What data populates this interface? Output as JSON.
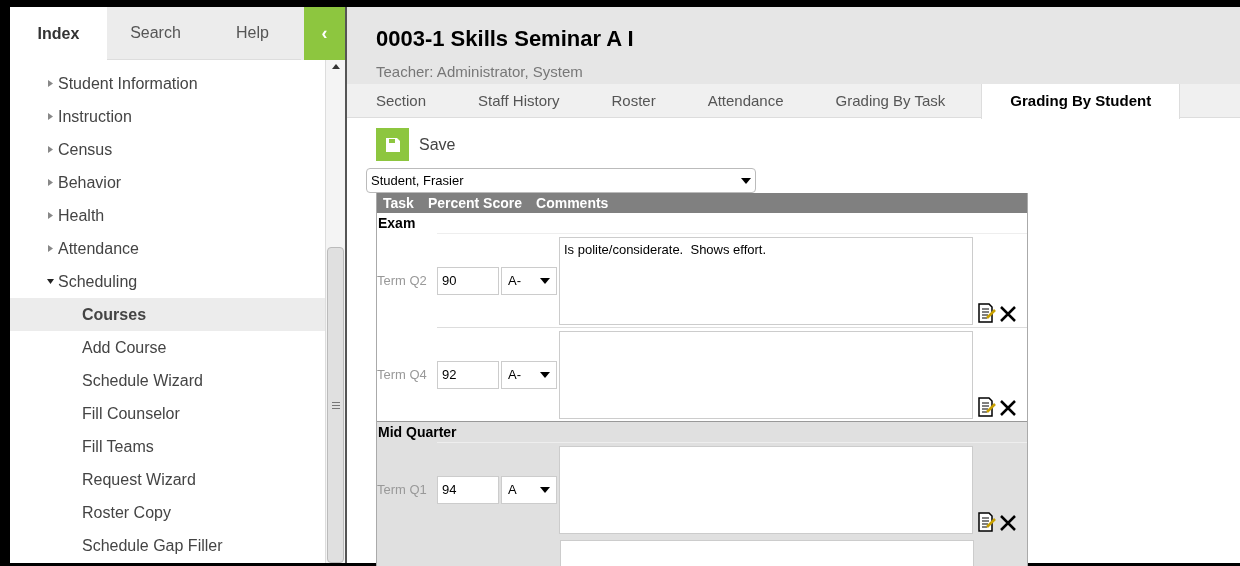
{
  "sidebar": {
    "tabs": [
      {
        "label": "Index",
        "selected": true
      },
      {
        "label": "Search",
        "selected": false
      },
      {
        "label": "Help",
        "selected": false
      }
    ],
    "collapse_button": "‹",
    "items": [
      {
        "label": "Student Information",
        "expanded": false
      },
      {
        "label": "Instruction",
        "expanded": false
      },
      {
        "label": "Census",
        "expanded": false
      },
      {
        "label": "Behavior",
        "expanded": false
      },
      {
        "label": "Health",
        "expanded": false
      },
      {
        "label": "Attendance",
        "expanded": false
      },
      {
        "label": "Scheduling",
        "expanded": true,
        "children": [
          {
            "label": "Courses",
            "selected": true
          },
          {
            "label": "Add Course",
            "selected": false
          },
          {
            "label": "Schedule Wizard",
            "selected": false
          },
          {
            "label": "Fill Counselor",
            "selected": false
          },
          {
            "label": "Fill Teams",
            "selected": false
          },
          {
            "label": "Request Wizard",
            "selected": false
          },
          {
            "label": "Roster Copy",
            "selected": false
          },
          {
            "label": "Schedule Gap Filler",
            "selected": false
          }
        ]
      }
    ]
  },
  "header": {
    "title": "0003-1 Skills Seminar A I",
    "teacher": "Teacher: Administrator, System"
  },
  "tabs": [
    {
      "label": "Section",
      "selected": false
    },
    {
      "label": "Staff History",
      "selected": false
    },
    {
      "label": "Roster",
      "selected": false
    },
    {
      "label": "Attendance",
      "selected": false
    },
    {
      "label": "Grading By Task",
      "selected": false
    },
    {
      "label": "Grading By Student",
      "selected": true
    }
  ],
  "save_button": "Save",
  "student_select": "Student, Frasier",
  "table": {
    "columns": [
      "Task",
      "Percent Score",
      "Comments"
    ],
    "groups": [
      {
        "name": "Exam",
        "shaded": false,
        "rows": [
          {
            "kind": "full",
            "term": "Term Q2",
            "score": "90",
            "grade": "A-",
            "comment": "Is polite/considerate.  Shows effort."
          },
          {
            "kind": "full",
            "term": "Term Q4",
            "score": "92",
            "grade": "A-",
            "comment": ""
          }
        ]
      },
      {
        "name": "Mid Quarter",
        "shaded": true,
        "rows": [
          {
            "kind": "full",
            "term": "Term Q1",
            "score": "94",
            "grade": "A",
            "comment": ""
          },
          {
            "kind": "partial"
          }
        ]
      }
    ]
  }
}
